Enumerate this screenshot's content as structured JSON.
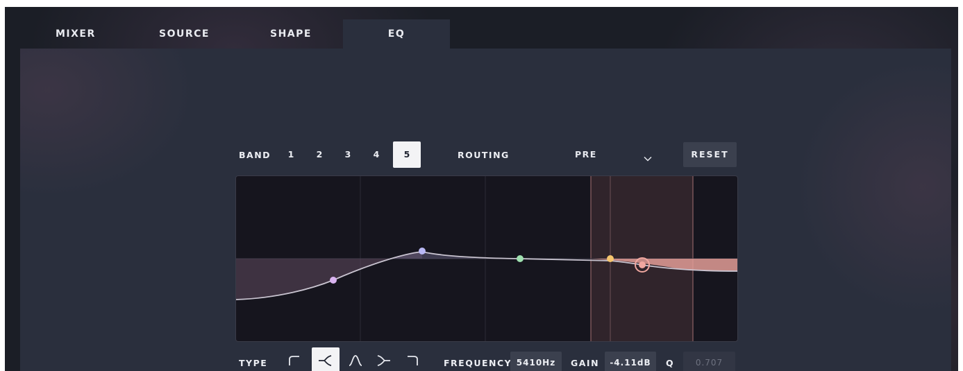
{
  "tabs": [
    {
      "label": "MIXER"
    },
    {
      "label": "SOURCE"
    },
    {
      "label": "SHAPE"
    },
    {
      "label": "EQ"
    }
  ],
  "active_tab": "EQ",
  "band": {
    "label": "BAND",
    "numbers": [
      "1",
      "2",
      "3",
      "4",
      "5"
    ],
    "selected": "5"
  },
  "routing": {
    "label": "ROUTING",
    "value": "PRE"
  },
  "reset_label": "RESET",
  "type": {
    "label": "TYPE",
    "options": [
      "low-cut-icon",
      "low-shelf-icon",
      "bell-icon",
      "high-shelf-icon",
      "high-cut-icon"
    ],
    "selected": "low-shelf-icon"
  },
  "frequency": {
    "label": "FREQUENCY",
    "value": "5410Hz"
  },
  "gain": {
    "label": "GAIN",
    "value": "-4.11dB"
  },
  "q": {
    "label": "Q",
    "value": "0.707"
  },
  "colors": {
    "background": "#1b1e26",
    "panel": "#2a2f3d",
    "graph_bg": "#16151e",
    "band1": "#d9b3f0",
    "band2": "#b9b8f4",
    "band3": "#9fe0b0",
    "band4": "#f5c56e",
    "band5": "#f0a7a0",
    "highlight": "#f3f3f5"
  }
}
